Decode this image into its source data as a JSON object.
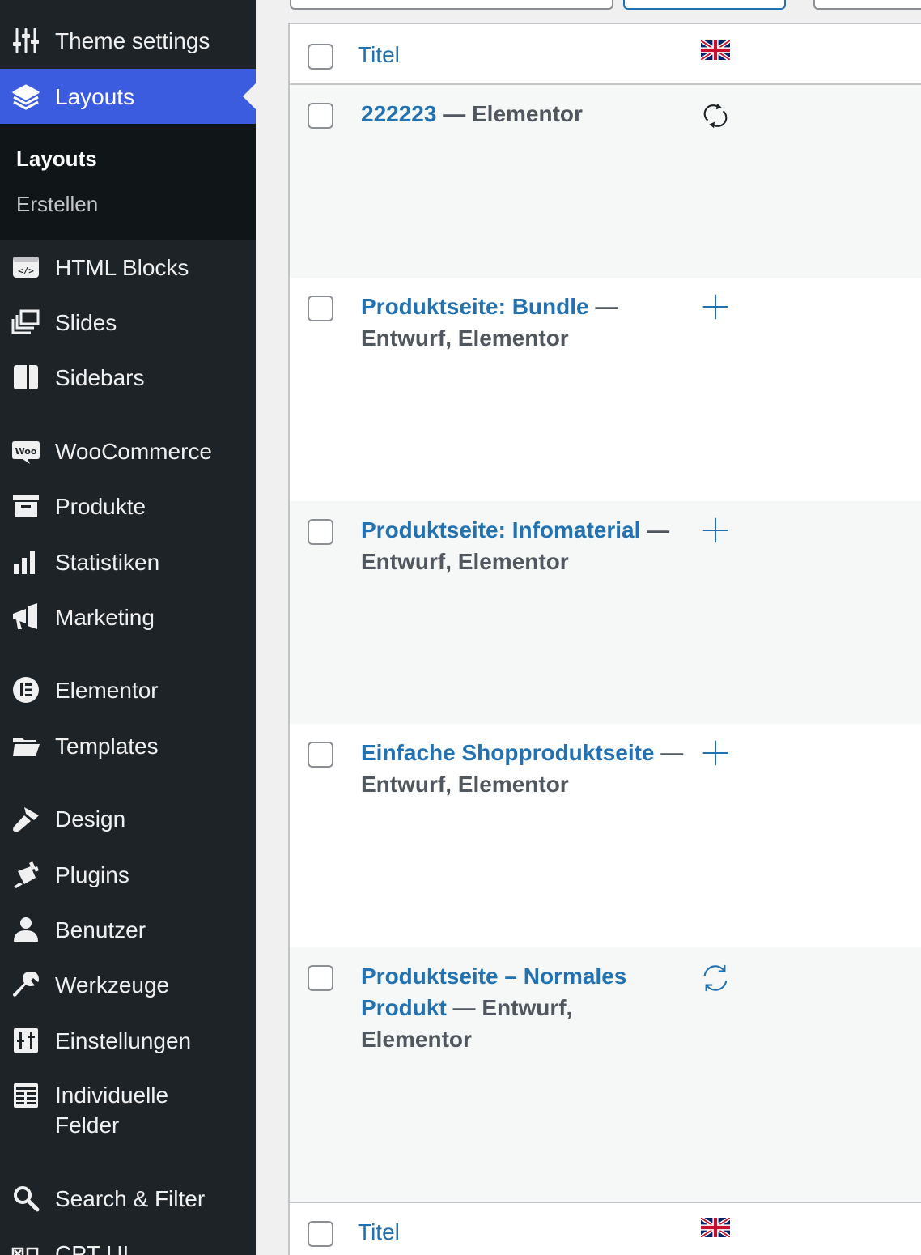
{
  "sidebar": {
    "items": [
      {
        "label": "Theme settings",
        "icon": "sliders-icon"
      },
      {
        "label": "Layouts",
        "icon": "layers-icon",
        "active": true
      },
      {
        "label": "HTML Blocks",
        "icon": "html-block-icon"
      },
      {
        "label": "Slides",
        "icon": "slides-icon"
      },
      {
        "label": "Sidebars",
        "icon": "sidebar-icon"
      },
      {
        "label": "WooCommerce",
        "icon": "woo-icon"
      },
      {
        "label": "Produkte",
        "icon": "archive-icon"
      },
      {
        "label": "Statistiken",
        "icon": "bar-chart-icon"
      },
      {
        "label": "Marketing",
        "icon": "megaphone-icon"
      },
      {
        "label": "Elementor",
        "icon": "elementor-icon"
      },
      {
        "label": "Templates",
        "icon": "folder-icon"
      },
      {
        "label": "Design",
        "icon": "brush-icon"
      },
      {
        "label": "Plugins",
        "icon": "plug-icon"
      },
      {
        "label": "Benutzer",
        "icon": "user-icon"
      },
      {
        "label": "Werkzeuge",
        "icon": "wrench-icon"
      },
      {
        "label": "Einstellungen",
        "icon": "settings-icon"
      },
      {
        "label": "Individuelle",
        "label2": "Felder",
        "icon": "fields-icon"
      },
      {
        "label": "Search & Filter",
        "icon": "search-icon"
      },
      {
        "label": "CPT UI",
        "icon": "cpt-icon"
      }
    ],
    "submenu": {
      "current": "Layouts",
      "other": "Erstellen"
    }
  },
  "table": {
    "header_title": "Titel",
    "footer_title": "Titel",
    "rows": [
      {
        "title": "222223",
        "state": " — Elementor",
        "status_icon": "sync-icon"
      },
      {
        "title": "Produktseite: Bundle",
        "state": " — Entwurf, Elementor",
        "status_icon": "plus-icon"
      },
      {
        "title": "Produktseite: Infomaterial",
        "state": " — Entwurf, Elementor",
        "status_icon": "plus-icon"
      },
      {
        "title": "Einfache Shopproduktseite",
        "state": " — Entwurf, Elementor",
        "status_icon": "plus-icon"
      },
      {
        "title": "Produktseite – Normales Produkt",
        "state": " — Entwurf, Elementor",
        "status_icon": "refresh-icon"
      }
    ]
  },
  "colors": {
    "sidebar_bg": "#1d2327",
    "active_bg": "#3c5cdf",
    "link": "#2271b1"
  }
}
